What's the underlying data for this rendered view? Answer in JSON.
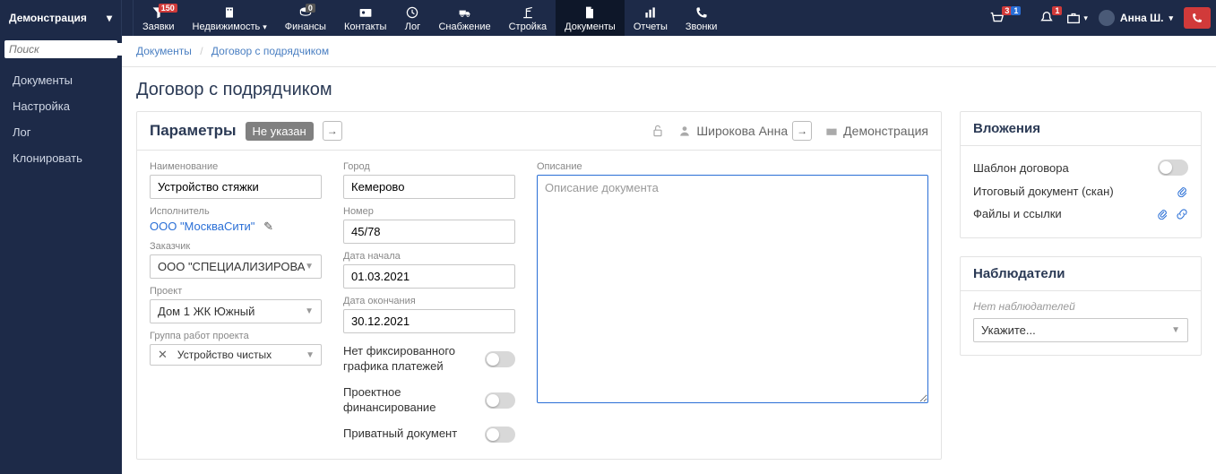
{
  "org_name": "Демонстрация",
  "nav": {
    "requests": {
      "label": "Заявки",
      "badge": "150"
    },
    "realty": "Недвижимость",
    "finance_badge": "0",
    "finance": "Финансы",
    "contacts": "Контакты",
    "log": "Лог",
    "supply": "Снабжение",
    "construction": "Стройка",
    "documents": "Документы",
    "reports": "Отчеты",
    "calls": "Звонки"
  },
  "topright": {
    "cart_badge1": "3",
    "cart_badge2": "1",
    "bell_badge": "1",
    "user": "Анна Ш."
  },
  "search_placeholder": "Поиск",
  "sidemenu": [
    "Документы",
    "Настройка",
    "Лог",
    "Клонировать"
  ],
  "breadcrumb": {
    "root": "Документы",
    "current": "Договор с подрядчиком"
  },
  "page_title": "Договор с подрядчиком",
  "params": {
    "title": "Параметры",
    "status": "Не указан",
    "owner": "Широкова Анна",
    "org": "Демонстрация",
    "fields": {
      "name_lbl": "Наименование",
      "name": "Устройство стяжки",
      "executor_lbl": "Исполнитель",
      "executor": "ООО \"МоскваСити\"",
      "customer_lbl": "Заказчик",
      "customer": "ООО \"СПЕЦИАЛИЗИРОВАННЫЙ",
      "project_lbl": "Проект",
      "project": "Дом 1 ЖК Южный",
      "group_lbl": "Группа работ проекта",
      "group": "Устройство чистых",
      "city_lbl": "Город",
      "city": "Кемерово",
      "number_lbl": "Номер",
      "number": "45/78",
      "date_start_lbl": "Дата начала",
      "date_start": "01.03.2021",
      "date_end_lbl": "Дата окончания",
      "date_end": "30.12.2021",
      "no_schedule": "Нет фиксированного графика платежей",
      "proj_finance": "Проектное финансирование",
      "private": "Приватный документ",
      "desc_lbl": "Описание",
      "desc_placeholder": "Описание документа"
    }
  },
  "attachments": {
    "title": "Вложения",
    "template": "Шаблон договора",
    "scan": "Итоговый документ (скан)",
    "files": "Файлы и ссылки"
  },
  "observers": {
    "title": "Наблюдатели",
    "empty": "Нет наблюдателей",
    "placeholder": "Укажите..."
  }
}
